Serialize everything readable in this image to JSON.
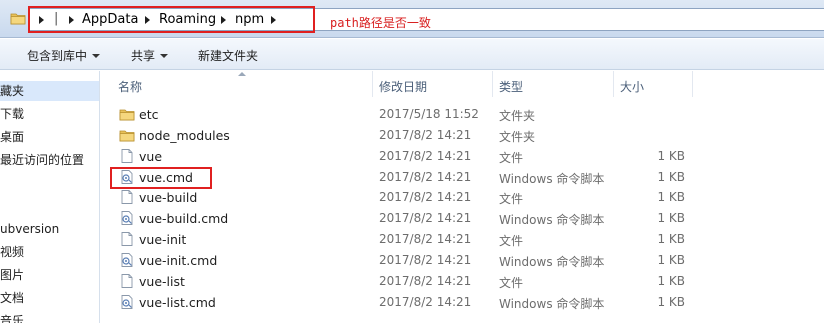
{
  "address_bar": {
    "breadcrumbs": [
      "AppData",
      "Roaming",
      "npm"
    ],
    "annotation": "path路径是否一致"
  },
  "toolbar": {
    "include_in_library": "包含到库中",
    "share": "共享",
    "new_folder": "新建文件夹"
  },
  "nav_pane": {
    "items": [
      "藏夹",
      "下载",
      "桌面",
      "最近访问的位置",
      "ubversion",
      "视频",
      "图片",
      "文档",
      "音乐"
    ]
  },
  "columns": {
    "name": "名称",
    "date": "修改日期",
    "type": "类型",
    "size": "大小"
  },
  "files": [
    {
      "name": "etc",
      "date": "2017/5/18 11:52",
      "type": "文件夹",
      "size": "",
      "icon": "folder-icon"
    },
    {
      "name": "node_modules",
      "date": "2017/8/2 14:21",
      "type": "文件夹",
      "size": "",
      "icon": "folder-icon"
    },
    {
      "name": "vue",
      "date": "2017/8/2 14:21",
      "type": "文件",
      "size": "1 KB",
      "icon": "file-icon"
    },
    {
      "name": "vue.cmd",
      "date": "2017/8/2 14:21",
      "type": "Windows 命令脚本",
      "size": "1 KB",
      "icon": "cmd-script-icon"
    },
    {
      "name": "vue-build",
      "date": "2017/8/2 14:21",
      "type": "文件",
      "size": "1 KB",
      "icon": "file-icon"
    },
    {
      "name": "vue-build.cmd",
      "date": "2017/8/2 14:21",
      "type": "Windows 命令脚本",
      "size": "1 KB",
      "icon": "cmd-script-icon"
    },
    {
      "name": "vue-init",
      "date": "2017/8/2 14:21",
      "type": "文件",
      "size": "1 KB",
      "icon": "file-icon"
    },
    {
      "name": "vue-init.cmd",
      "date": "2017/8/2 14:21",
      "type": "Windows 命令脚本",
      "size": "1 KB",
      "icon": "cmd-script-icon"
    },
    {
      "name": "vue-list",
      "date": "2017/8/2 14:21",
      "type": "文件",
      "size": "1 KB",
      "icon": "file-icon"
    },
    {
      "name": "vue-list.cmd",
      "date": "2017/8/2 14:21",
      "type": "Windows 命令脚本",
      "size": "1 KB",
      "icon": "cmd-script-icon"
    }
  ],
  "colors": {
    "highlight": "#e02020",
    "annotation": "#d81e1e",
    "selection": "#d9e8fb",
    "folder": "#e8c15a"
  }
}
